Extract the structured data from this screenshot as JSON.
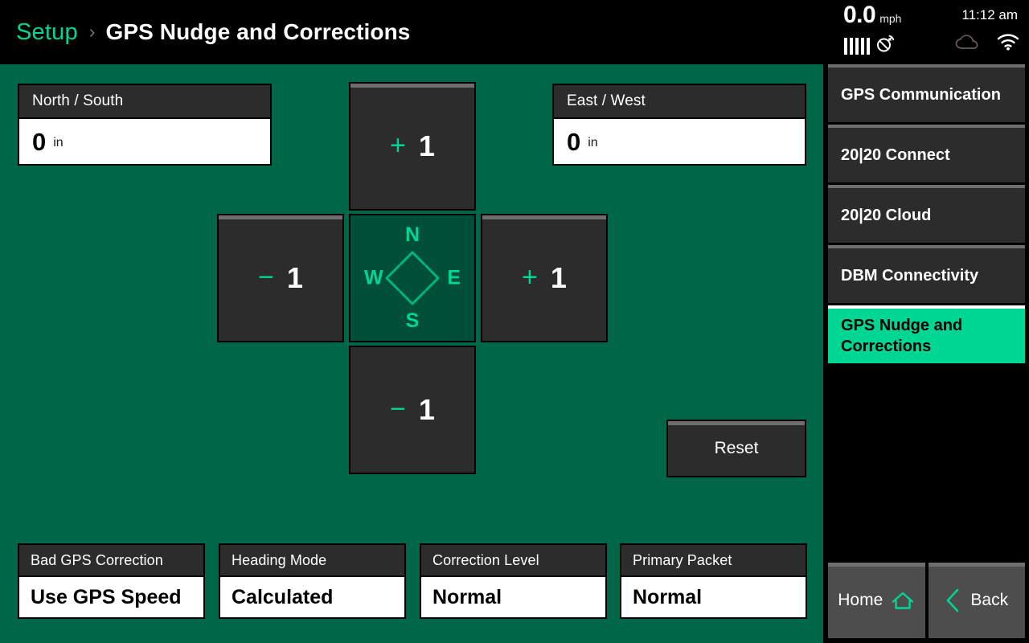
{
  "breadcrumb": {
    "parent": "Setup",
    "separator": "›",
    "current": "GPS Nudge and Corrections"
  },
  "status": {
    "speed_value": "0.0",
    "speed_unit": "mph",
    "time": "11:12 am",
    "gps_bars": 5,
    "icons": {
      "satellite": "satellite-icon",
      "cloud": "cloud-icon",
      "wifi": "wifi-icon"
    }
  },
  "fields": {
    "north_south": {
      "label": "North / South",
      "value": "0",
      "unit": "in"
    },
    "east_west": {
      "label": "East / West",
      "value": "0",
      "unit": "in"
    }
  },
  "nudge": {
    "up": {
      "sign": "+",
      "amount": "1"
    },
    "down": {
      "sign": "−",
      "amount": "1"
    },
    "left": {
      "sign": "−",
      "amount": "1"
    },
    "right": {
      "sign": "+",
      "amount": "1"
    }
  },
  "compass": {
    "north": "N",
    "south": "S",
    "east": "E",
    "west": "W"
  },
  "reset": {
    "label": "Reset"
  },
  "settings": [
    {
      "label": "Bad GPS Correction",
      "value": "Use GPS Speed"
    },
    {
      "label": "Heading Mode",
      "value": "Calculated"
    },
    {
      "label": "Correction Level",
      "value": "Normal"
    },
    {
      "label": "Primary Packet",
      "value": "Normal"
    }
  ],
  "sidebar": {
    "items": [
      {
        "label": "GPS Communication",
        "active": false
      },
      {
        "label": "20|20 Connect",
        "active": false
      },
      {
        "label": "20|20 Cloud",
        "active": false
      },
      {
        "label": "DBM Connectivity",
        "active": false
      },
      {
        "label": "GPS Nudge and Corrections",
        "active": true
      }
    ],
    "nav": {
      "home": "Home",
      "back": "Back"
    }
  },
  "colors": {
    "background_green": "#006648",
    "accent_teal": "#00d694",
    "panel_dark": "#2c2c2c",
    "compass_green": "#004f38"
  }
}
